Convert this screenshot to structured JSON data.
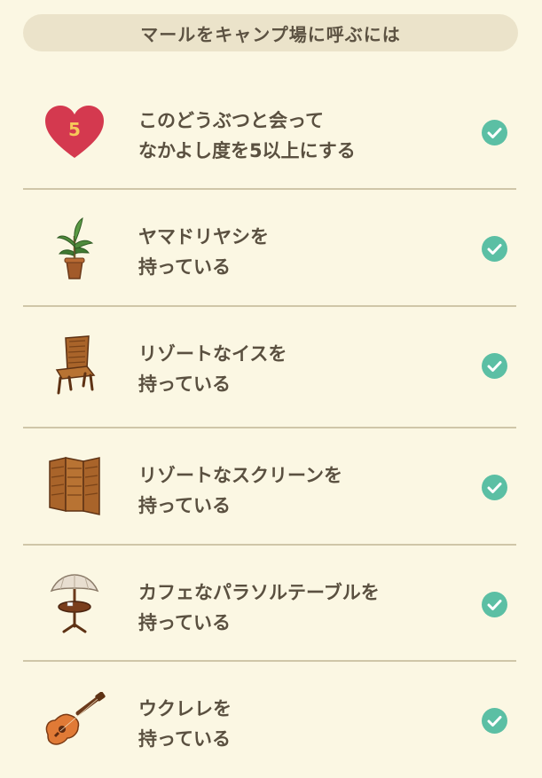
{
  "header": {
    "title": "マールをキャンプ場に呼ぶには"
  },
  "conditions": [
    {
      "icon": "heart-icon",
      "heart_number": "5",
      "line1": "このどうぶつと会って",
      "line2": "なかよし度を5以上にする",
      "done": true
    },
    {
      "icon": "potted-palm-icon",
      "line1": "ヤマドリヤシを",
      "line2": "持っている",
      "done": true
    },
    {
      "icon": "resort-chair-icon",
      "line1": "リゾートなイスを",
      "line2": "持っている",
      "done": true
    },
    {
      "icon": "resort-screen-icon",
      "line1": "リゾートなスクリーンを",
      "line2": "持っている",
      "done": true
    },
    {
      "icon": "parasol-table-icon",
      "line1": "カフェなパラソルテーブルを",
      "line2": "持っている",
      "done": true
    },
    {
      "icon": "ukulele-icon",
      "line1": "ウクレレを",
      "line2": "持っている",
      "done": true
    }
  ],
  "colors": {
    "background": "#fbf7e3",
    "header_bg": "#ebe3ca",
    "check": "#5bbfa4",
    "heart": "#d4394f",
    "divider": "#cfc6a8"
  }
}
